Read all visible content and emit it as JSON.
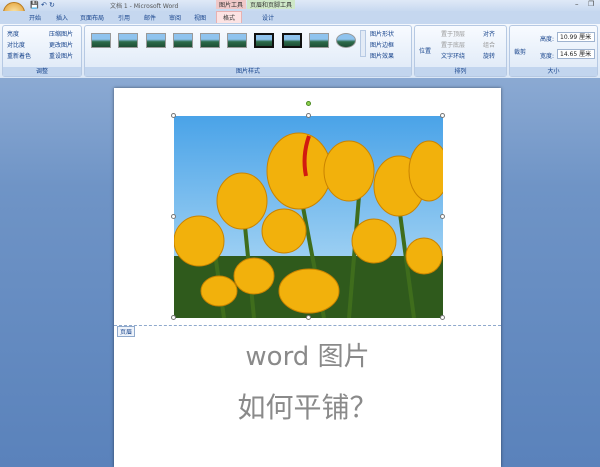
{
  "window": {
    "title": "文档 1 - Microsoft Word",
    "context_tools": [
      "图片工具",
      "页眉和页脚工具"
    ]
  },
  "tabs": [
    "开始",
    "插入",
    "页面布局",
    "引用",
    "邮件",
    "审阅",
    "视图",
    "格式",
    "设计"
  ],
  "ribbon": {
    "adjust": {
      "label": "调整",
      "items": [
        "亮度",
        "对比度",
        "重新着色",
        "压缩图片",
        "更改图片",
        "重设图片"
      ]
    },
    "styles": {
      "label": "图片样式",
      "items": [
        "图片形状",
        "图片边框",
        "图片效果"
      ]
    },
    "arrange": {
      "label": "排列",
      "items": [
        "位置",
        "置于顶层",
        "置于底层",
        "文字环绕",
        "对齐",
        "组合",
        "旋转"
      ]
    },
    "size": {
      "label": "大小",
      "crop": "裁剪",
      "height_label": "高度:",
      "height": "10.99 厘米",
      "width_label": "宽度:",
      "width": "14.65 厘米"
    }
  },
  "document": {
    "header_label": "页眉",
    "line1": "word 图片",
    "line2": "如何平铺？"
  }
}
